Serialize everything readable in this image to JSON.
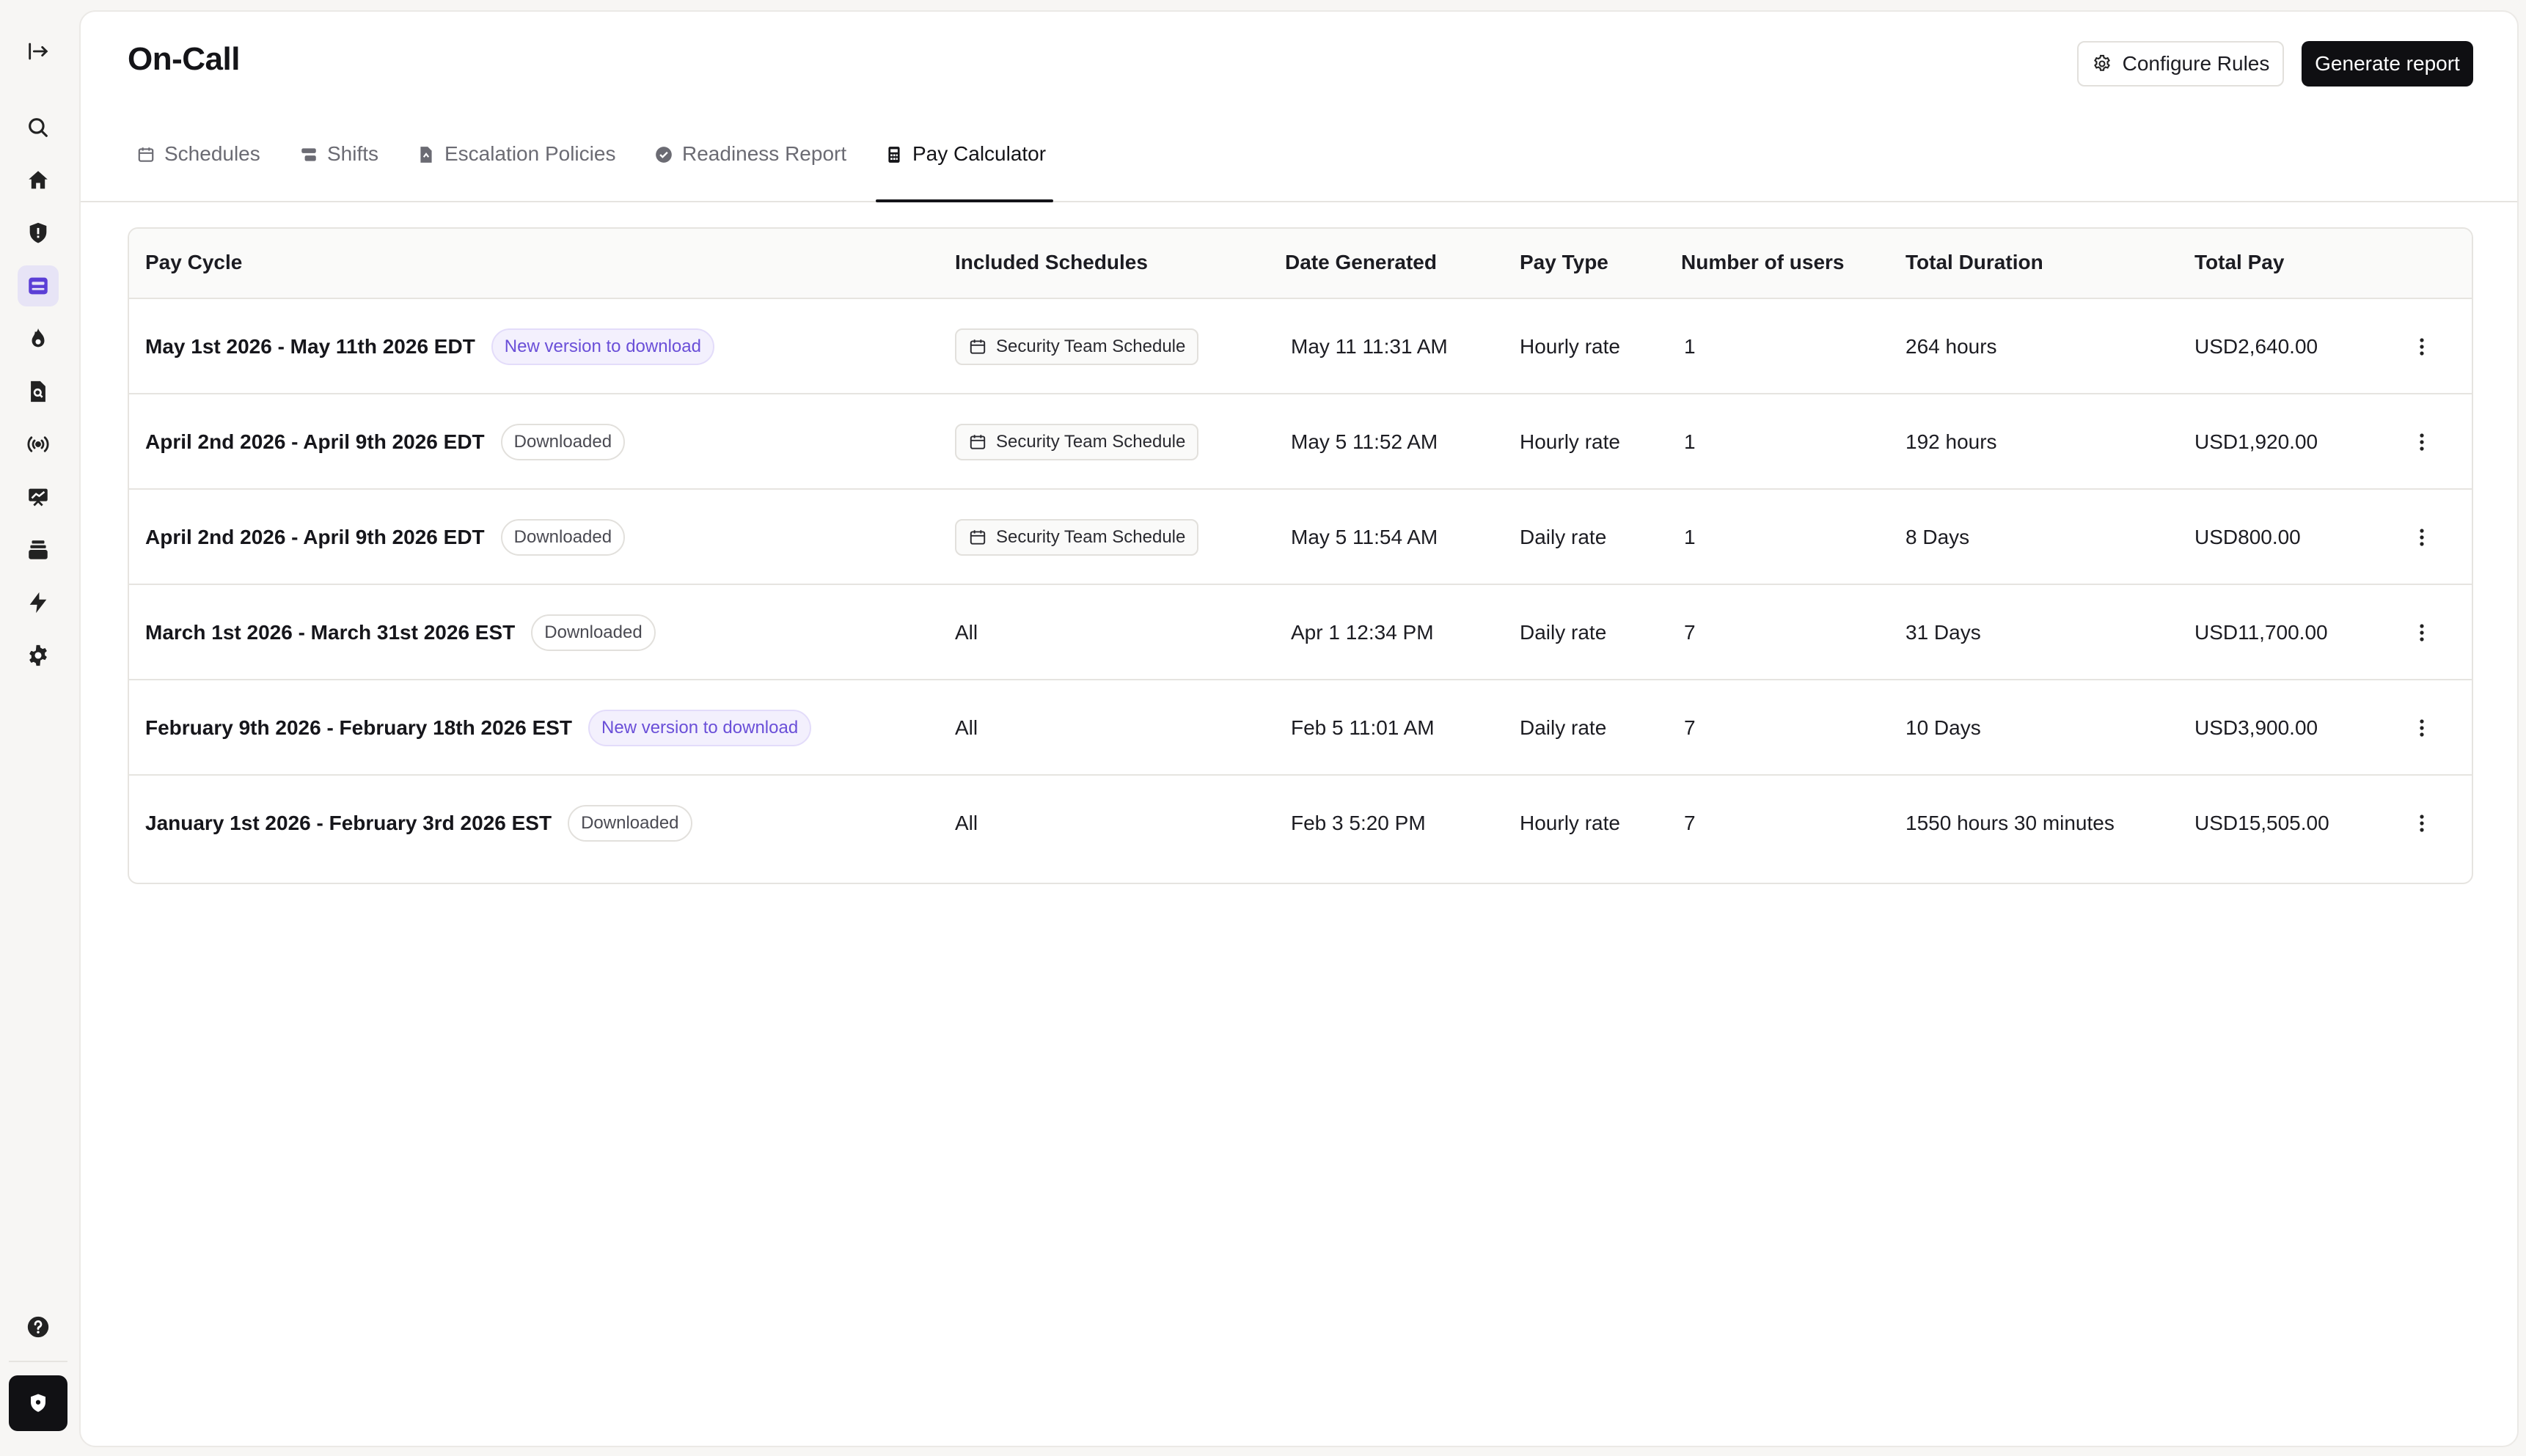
{
  "sidebar": {
    "icons": [
      {
        "name": "expand-sidebar-icon"
      },
      {
        "name": "search-icon"
      },
      {
        "name": "home-icon"
      },
      {
        "name": "shield-alert-icon"
      },
      {
        "name": "on-call-icon"
      },
      {
        "name": "incidents-fire-icon"
      },
      {
        "name": "document-search-icon"
      },
      {
        "name": "broadcast-icon"
      },
      {
        "name": "presentation-icon"
      },
      {
        "name": "catalog-icon"
      },
      {
        "name": "lightning-icon"
      },
      {
        "name": "settings-icon"
      },
      {
        "name": "help-icon"
      },
      {
        "name": "workspace-logo-icon"
      }
    ],
    "active": "on-call-icon"
  },
  "header": {
    "title": "On-Call",
    "configure_label": "Configure Rules",
    "generate_label": "Generate report"
  },
  "tabs": [
    {
      "label": "Schedules",
      "icon": "calendar-icon"
    },
    {
      "label": "Shifts",
      "icon": "shifts-icon"
    },
    {
      "label": "Escalation Policies",
      "icon": "escalation-icon"
    },
    {
      "label": "Readiness Report",
      "icon": "check-circle-icon"
    },
    {
      "label": "Pay Calculator",
      "icon": "calculator-icon",
      "active": true
    }
  ],
  "table": {
    "columns": [
      "Pay Cycle",
      "Included Schedules",
      "Date Generated",
      "Pay Type",
      "Number of users",
      "Total Duration",
      "Total Pay"
    ],
    "rows": [
      {
        "cycle": "May 1st 2026 - May 11th 2026 EDT",
        "status": "New version to download",
        "status_kind": "new",
        "schedule": "Security Team Schedule",
        "schedule_kind": "chip",
        "date": "May 11 11:31 AM",
        "pay_type": "Hourly rate",
        "users": "1",
        "duration": "264 hours",
        "total": "USD2,640.00"
      },
      {
        "cycle": "April 2nd 2026 - April 9th 2026 EDT",
        "status": "Downloaded",
        "status_kind": "dl",
        "schedule": "Security Team Schedule",
        "schedule_kind": "chip",
        "date": "May 5 11:52 AM",
        "pay_type": "Hourly rate",
        "users": "1",
        "duration": "192 hours",
        "total": "USD1,920.00"
      },
      {
        "cycle": "April 2nd 2026 - April 9th 2026 EDT",
        "status": "Downloaded",
        "status_kind": "dl",
        "schedule": "Security Team Schedule",
        "schedule_kind": "chip",
        "date": "May 5 11:54 AM",
        "pay_type": "Daily rate",
        "users": "1",
        "duration": "8 Days",
        "total": "USD800.00"
      },
      {
        "cycle": "March 1st 2026 - March 31st 2026 EST",
        "status": "Downloaded",
        "status_kind": "dl",
        "schedule": "All",
        "schedule_kind": "text",
        "date": "Apr 1 12:34 PM",
        "pay_type": "Daily rate",
        "users": "7",
        "duration": "31 Days",
        "total": "USD11,700.00"
      },
      {
        "cycle": "February 9th 2026 - February 18th 2026 EST",
        "status": "New version to download",
        "status_kind": "new",
        "schedule": "All",
        "schedule_kind": "text",
        "date": "Feb 5 11:01 AM",
        "pay_type": "Daily rate",
        "users": "7",
        "duration": "10 Days",
        "total": "USD3,900.00"
      },
      {
        "cycle": "January 1st 2026 - February 3rd 2026 EST",
        "status": "Downloaded",
        "status_kind": "dl",
        "schedule": "All",
        "schedule_kind": "text",
        "date": "Feb 3 5:20 PM",
        "pay_type": "Hourly rate",
        "users": "7",
        "duration": "1550 hours 30 minutes",
        "total": "USD15,505.00"
      }
    ]
  },
  "colors": {
    "accent": "#5b3fd6",
    "badge_new_text": "#6a4fd8",
    "primary_button": "#0f0f12"
  }
}
